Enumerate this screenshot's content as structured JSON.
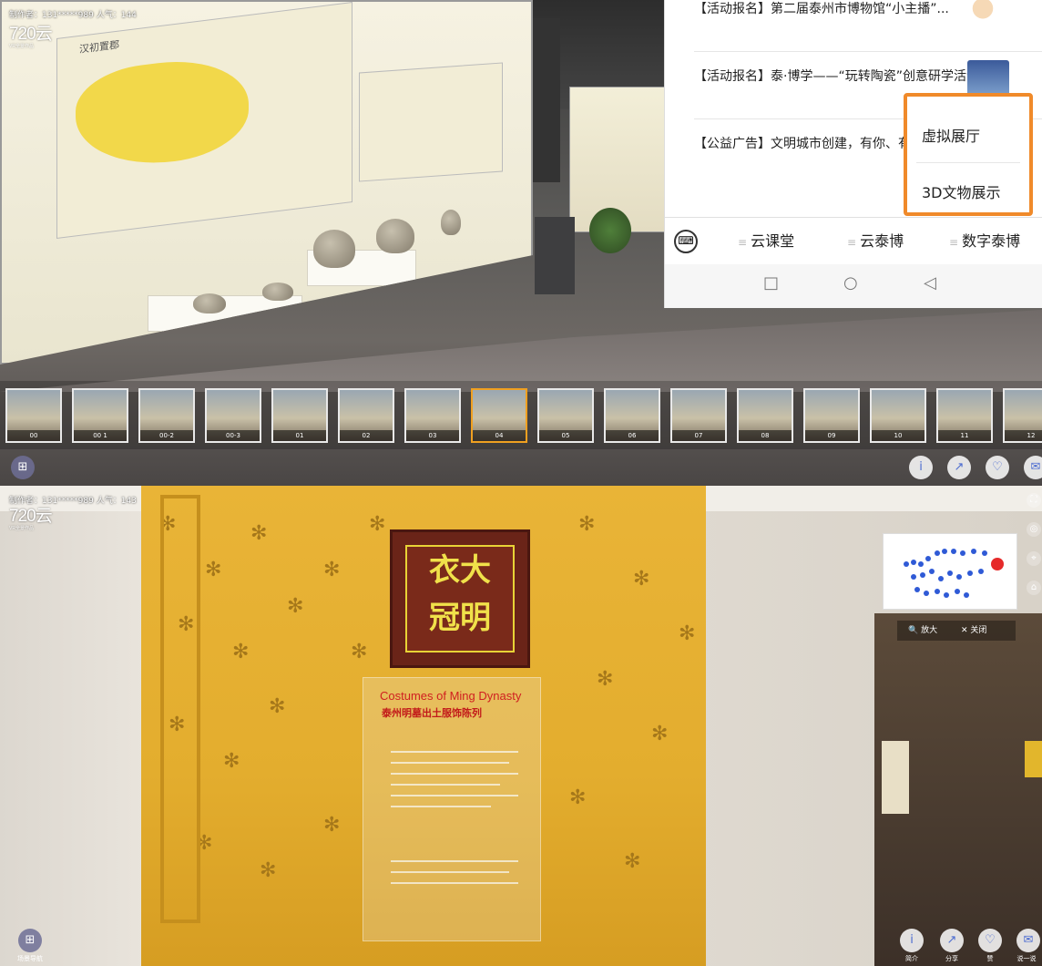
{
  "top_scene": {
    "meta": "制作者：131*****989  人气：144",
    "logo": "720云",
    "logo_sub": "VR全景作品",
    "case_title": "汉初置郡",
    "thumbnails": [
      "00",
      "00 1",
      "00-2",
      "00-3",
      "01",
      "02",
      "03",
      "04",
      "05",
      "06",
      "07",
      "08",
      "09",
      "10",
      "11",
      "12"
    ],
    "active_thumbnail": "04"
  },
  "phone": {
    "news": [
      {
        "text": "【活动报名】第二届泰州市博物馆“小主播”..."
      },
      {
        "text": "【活动报名】泰·博学——“玩转陶瓷”创意研学活动"
      },
      {
        "text": "【公益广告】文明城市创建，有你、有我，也有他"
      }
    ],
    "popup": [
      "虚拟展厅",
      "3D文物展示"
    ],
    "popup_border_color": "#f08a2a",
    "tabs": [
      "云课堂",
      "云泰博",
      "数字泰博"
    ],
    "nav_icons": [
      "square-icon",
      "circle-icon",
      "back-triangle-icon"
    ]
  },
  "bottom_scene": {
    "meta": "制作者：131*****989  人气：143",
    "logo": "720云",
    "logo_sub": "VR全景作品",
    "sign_chars": [
      "大",
      "衣",
      "明",
      "冠"
    ],
    "plaque_title": "Costumes of Ming Dynasty",
    "plaque_subtitle": "泰州明墓出土服饰陈列",
    "scene_nav_label": "场景导航",
    "map_zoom": "放大",
    "map_close": "关闭",
    "buttons": [
      "简介",
      "分享",
      "赞",
      "说一说"
    ]
  }
}
